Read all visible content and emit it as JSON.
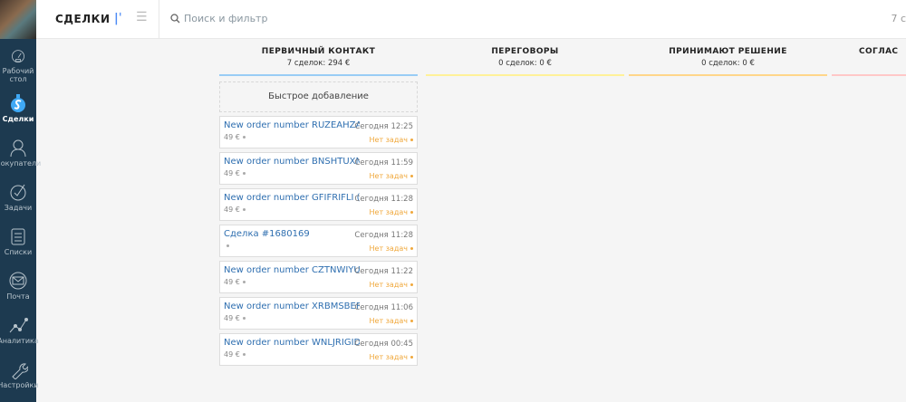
{
  "sidebar": {
    "items": [
      {
        "label": "Рабочий стол",
        "icon": "dashboard-icon"
      },
      {
        "label": "Сделки",
        "icon": "deals-icon",
        "active": true
      },
      {
        "label": "Покупатели",
        "icon": "customers-icon"
      },
      {
        "label": "Задачи",
        "icon": "tasks-icon"
      },
      {
        "label": "Списки",
        "icon": "lists-icon"
      },
      {
        "label": "Почта",
        "icon": "mail-icon"
      },
      {
        "label": "Аналитика",
        "icon": "analytics-icon"
      },
      {
        "label": "Настройки",
        "icon": "settings-icon"
      }
    ]
  },
  "header": {
    "title": "СДЕЛКИ",
    "search_placeholder": "Поиск и фильтр",
    "count": "7 с"
  },
  "columns": [
    {
      "name": "ПЕРВИЧНЫЙ КОНТАКТ",
      "summary": "7 сделок: 294 €",
      "color": "#99ccf5"
    },
    {
      "name": "ПЕРЕГОВОРЫ",
      "summary": "0 сделок: 0 €",
      "color": "#fff199"
    },
    {
      "name": "ПРИНИМАЮТ РЕШЕНИЕ",
      "summary": "0 сделок: 0 €",
      "color": "#ffd68a"
    },
    {
      "name": "СОГЛАС",
      "summary": "",
      "color": "#ffc8c8"
    }
  ],
  "quick_add": "Быстрое добавление",
  "cards": [
    {
      "name": "New order number RUZEAHZA...",
      "time": "Сегодня 12:25",
      "price": "49 €",
      "tasks": "Нет задач"
    },
    {
      "name": "New order number BNSHTUXM...",
      "time": "Сегодня 11:59",
      "price": "49 €",
      "tasks": "Нет задач"
    },
    {
      "name": "New order number GFIFRIFLI (#...",
      "time": "Сегодня 11:28",
      "price": "49 €",
      "tasks": "Нет задач"
    },
    {
      "name": "Сделка #1680169",
      "time": "Сегодня 11:28",
      "price": "",
      "tasks": "Нет задач"
    },
    {
      "name": "New order number CZTNWIYUN...",
      "time": "Сегодня 11:22",
      "price": "49 €",
      "tasks": "Нет задач"
    },
    {
      "name": "New order number XRBMSBER...",
      "time": "Сегодня 11:06",
      "price": "49 €",
      "tasks": "Нет задач"
    },
    {
      "name": "New order number WNLJRIGID (...",
      "time": "Сегодня 00:45",
      "price": "49 €",
      "tasks": "Нет задач"
    }
  ]
}
